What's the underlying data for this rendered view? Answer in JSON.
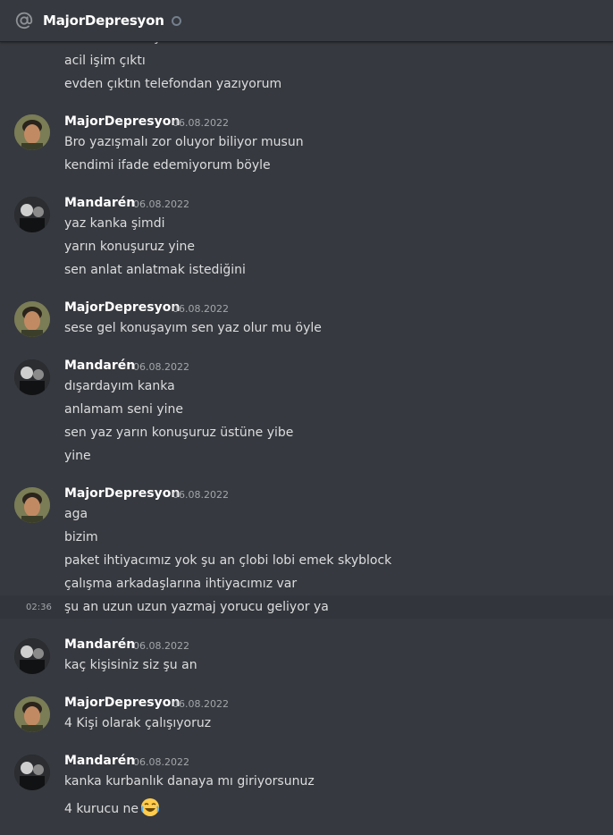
{
  "header": {
    "title": "MajorDepresyon"
  },
  "icons": {
    "mention": "at-icon",
    "status": "offline-status-icon",
    "emoji": "joy-emoji-icon"
  },
  "colors": {
    "background": "#36393f",
    "text": "#dcddde",
    "author": "#ffffff",
    "timestamp": "#a3a6aa"
  },
  "top_partial_message": {
    "lines": [
      "kanka burdan yazsana",
      "acil işim çıktı",
      "evden çıktın telefondan yazıyorum"
    ]
  },
  "messages": [
    {
      "author": "MajorDepresyon",
      "time": "06.08.2022",
      "avatar": "major",
      "lines": [
        "Bro yazışmalı zor oluyor biliyor musun",
        "kendimi ifade edemiyorum böyle"
      ]
    },
    {
      "author": "Mandarén",
      "time": "06.08.2022",
      "avatar": "mandaren",
      "lines": [
        "yaz kanka şimdi",
        "yarın konuşuruz yine",
        "sen anlat anlatmak istediğini"
      ]
    },
    {
      "author": "MajorDepresyon",
      "time": "06.08.2022",
      "avatar": "major",
      "lines": [
        "sese gel konuşayım sen yaz olur mu öyle"
      ]
    },
    {
      "author": "Mandarén",
      "time": "06.08.2022",
      "avatar": "mandaren",
      "lines": [
        "dışardayım kanka",
        "anlamam seni yine",
        "sen yaz yarın konuşuruz üstüne yibe",
        "yine"
      ]
    },
    {
      "author": "MajorDepresyon",
      "time": "06.08.2022",
      "avatar": "major",
      "lines": [
        "aga",
        "bizim",
        "paket ihtiyacımız yok şu an çlobi lobi emek skyblock",
        "çalışma arkadaşlarına ihtiyacımız var",
        "şu an uzun uzun yazmaj yorucu geliyor ya"
      ],
      "hover_time": "02:36"
    },
    {
      "author": "Mandarén",
      "time": "06.08.2022",
      "avatar": "mandaren",
      "lines": [
        "kaç kişisiniz siz şu an"
      ]
    },
    {
      "author": "MajorDepresyon",
      "time": "06.08.2022",
      "avatar": "major",
      "lines": [
        "4 Kişi olarak çalışıyoruz"
      ]
    },
    {
      "author": "Mandarén",
      "time": "06.08.2022",
      "avatar": "mandaren",
      "lines": [
        "kanka kurbanlık danaya mı giriyorsunuz",
        "4 kurucu ne"
      ]
    }
  ]
}
